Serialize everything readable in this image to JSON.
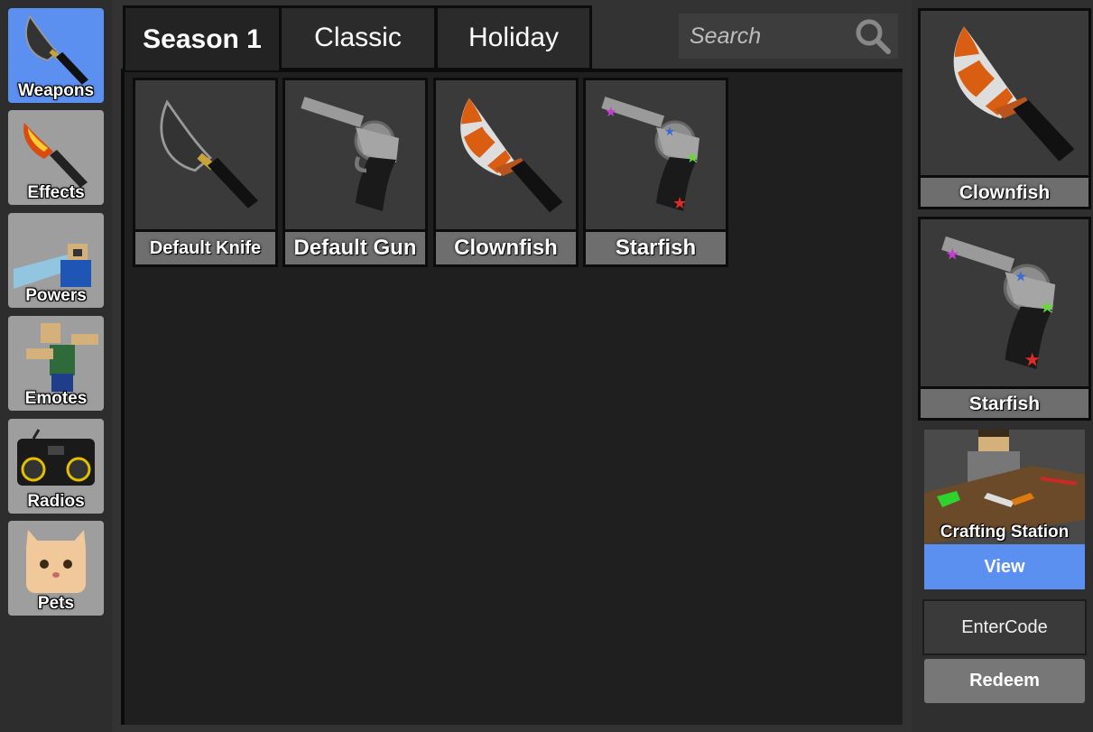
{
  "sidebar": {
    "items": [
      {
        "label": "Weapons",
        "icon": "knife-icon",
        "active": true
      },
      {
        "label": "Effects",
        "icon": "fire-knife-icon"
      },
      {
        "label": "Powers",
        "icon": "power-character-icon"
      },
      {
        "label": "Emotes",
        "icon": "emote-character-icon"
      },
      {
        "label": "Radios",
        "icon": "boombox-icon"
      },
      {
        "label": "Pets",
        "icon": "cat-icon"
      }
    ]
  },
  "tabs": [
    {
      "label": "Season 1",
      "active": true
    },
    {
      "label": "Classic"
    },
    {
      "label": "Holiday"
    }
  ],
  "search": {
    "placeholder": "Search"
  },
  "items": [
    {
      "name": "Default Knife",
      "icon": "knife-icon"
    },
    {
      "name": "Default Gun",
      "icon": "revolver-icon"
    },
    {
      "name": "Clownfish",
      "icon": "clownfish-knife-icon"
    },
    {
      "name": "Starfish",
      "icon": "starfish-gun-icon"
    }
  ],
  "equipped": {
    "knife": {
      "name": "Clownfish",
      "icon": "clownfish-knife-icon"
    },
    "gun": {
      "name": "Starfish",
      "icon": "starfish-gun-icon"
    }
  },
  "crafting": {
    "label": "Crafting Station",
    "button": "View"
  },
  "code": {
    "placeholder": "EnterCode",
    "button": "Redeem"
  },
  "colors": {
    "accent": "#5b8ff0",
    "panel": "#1f1f1f",
    "card": "#3a3a3a",
    "label_bar": "#6e6e6e"
  }
}
